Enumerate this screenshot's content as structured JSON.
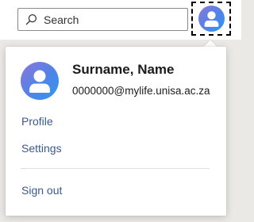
{
  "header": {
    "search": {
      "placeholder": "Search",
      "icon": "search-icon"
    },
    "account_button": {
      "icon": "person-icon"
    }
  },
  "account_menu": {
    "user": {
      "name": "Surname, Name",
      "email": "0000000@mylife.unisa.ac.za",
      "avatar_icon": "person-icon"
    },
    "links": {
      "profile": "Profile",
      "settings": "Settings",
      "sign_out": "Sign out"
    }
  },
  "colors": {
    "link": "#3a5a8c",
    "avatar_gradient": [
      "#8c78d8",
      "#4f83e8",
      "#2f98f0"
    ],
    "text": "#1b1b1b",
    "backdrop": "#ebe9e6"
  }
}
